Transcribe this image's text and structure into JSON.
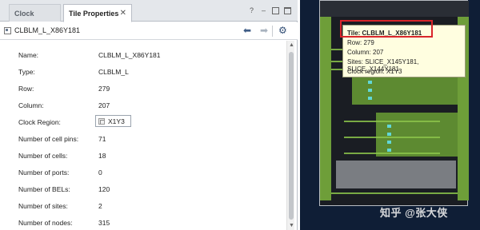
{
  "tabs": [
    {
      "label": "Clock Regions",
      "active": false
    },
    {
      "label": "Tile Properties",
      "active": true
    }
  ],
  "window_buttons": {
    "help": "?",
    "minimize": "–"
  },
  "toolbar": {
    "title": "CLBLM_L_X86Y181",
    "back_icon": "arrow-left-icon",
    "forward_icon": "arrow-right-icon",
    "settings_icon": "gear-icon"
  },
  "properties": [
    {
      "key": "Name:",
      "value": "CLBLM_L_X86Y181"
    },
    {
      "key": "Type:",
      "value": "CLBLM_L"
    },
    {
      "key": "Row:",
      "value": "279"
    },
    {
      "key": "Column:",
      "value": "207"
    },
    {
      "key": "Clock Region:",
      "value": "X1Y3"
    },
    {
      "key": "Number of cell pins:",
      "value": "71"
    },
    {
      "key": "Number of cells:",
      "value": "18"
    },
    {
      "key": "Number of ports:",
      "value": "0"
    },
    {
      "key": "Number of BELs:",
      "value": "120"
    },
    {
      "key": "Number of sites:",
      "value": "2"
    },
    {
      "key": "Number of nodes:",
      "value": "315"
    }
  ],
  "tooltip": {
    "tile": "Tile: CLBLM_L_X86Y181",
    "row": "Row: 279",
    "column": "Column: 207",
    "sites": "Sites: SLICE_X145Y181, SLICE_X144Y181",
    "clock_region": "Clock region: X1Y3"
  },
  "watermark": "知乎 @张大侠",
  "colors": {
    "highlight": "#d9252b",
    "routing": "#8bc34a",
    "background": "#0f1e36"
  }
}
